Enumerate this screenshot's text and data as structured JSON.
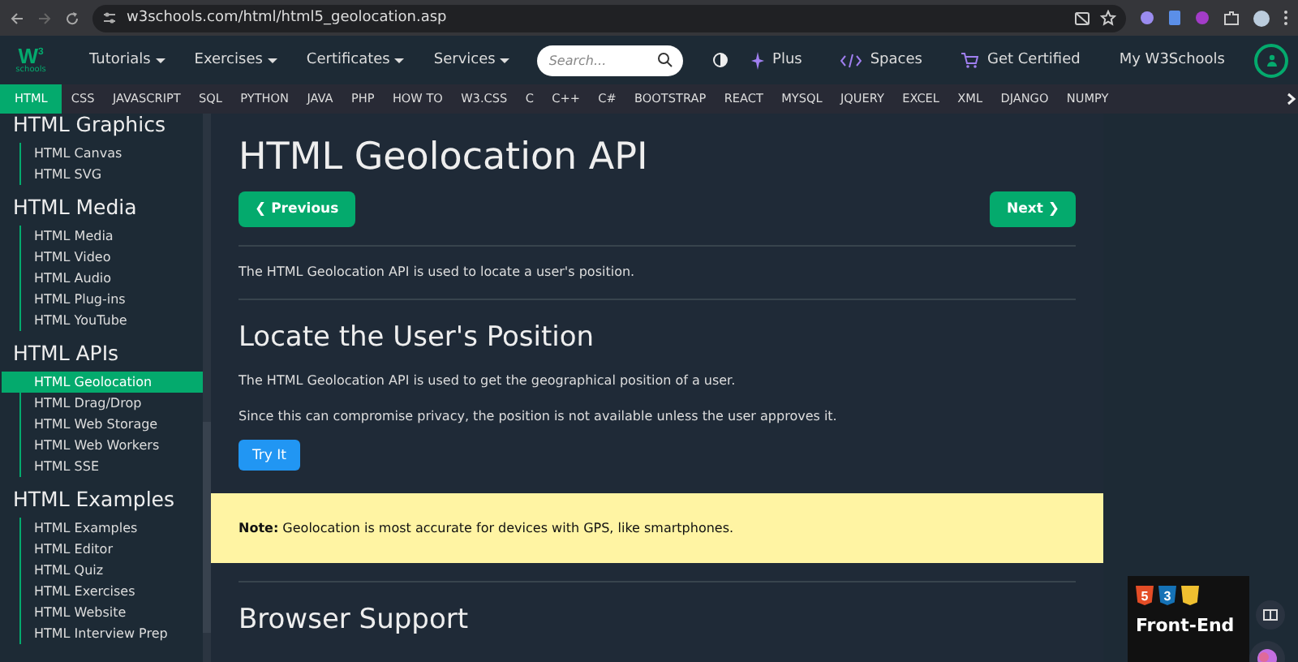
{
  "browser": {
    "url": "w3schools.com/html/html5_geolocation.asp"
  },
  "logo": {
    "mark": "W",
    "sup": "3",
    "word": "schools"
  },
  "top_nav": {
    "menus": [
      "Tutorials",
      "Exercises",
      "Certificates",
      "Services"
    ],
    "search": {
      "placeholder": "Search..."
    },
    "right_links": [
      {
        "kind": "plus",
        "label": "Plus"
      },
      {
        "kind": "spaces",
        "label": "Spaces"
      },
      {
        "kind": "cart",
        "label": "Get Certified"
      },
      {
        "kind": "plain",
        "label": "My W3Schools"
      }
    ]
  },
  "sub_nav": [
    {
      "label": "HTML",
      "selected": true
    },
    {
      "label": "CSS",
      "selected": false
    },
    {
      "label": "JAVASCRIPT",
      "selected": false
    },
    {
      "label": "SQL",
      "selected": false
    },
    {
      "label": "PYTHON",
      "selected": false
    },
    {
      "label": "JAVA",
      "selected": false
    },
    {
      "label": "PHP",
      "selected": false
    },
    {
      "label": "HOW TO",
      "selected": false
    },
    {
      "label": "W3.CSS",
      "selected": false
    },
    {
      "label": "C",
      "selected": false
    },
    {
      "label": "C++",
      "selected": false
    },
    {
      "label": "C#",
      "selected": false
    },
    {
      "label": "BOOTSTRAP",
      "selected": false
    },
    {
      "label": "REACT",
      "selected": false
    },
    {
      "label": "MYSQL",
      "selected": false
    },
    {
      "label": "JQUERY",
      "selected": false
    },
    {
      "label": "EXCEL",
      "selected": false
    },
    {
      "label": "XML",
      "selected": false
    },
    {
      "label": "DJANGO",
      "selected": false
    },
    {
      "label": "NUMPY",
      "selected": false
    }
  ],
  "sidebar": {
    "sections": [
      {
        "title": "HTML Graphics",
        "items": [
          {
            "label": "HTML Canvas",
            "selected": false
          },
          {
            "label": "HTML SVG",
            "selected": false
          }
        ]
      },
      {
        "title": "HTML Media",
        "items": [
          {
            "label": "HTML Media",
            "selected": false
          },
          {
            "label": "HTML Video",
            "selected": false
          },
          {
            "label": "HTML Audio",
            "selected": false
          },
          {
            "label": "HTML Plug-ins",
            "selected": false
          },
          {
            "label": "HTML YouTube",
            "selected": false
          }
        ]
      },
      {
        "title": "HTML APIs",
        "items": [
          {
            "label": "HTML Geolocation",
            "selected": true
          },
          {
            "label": "HTML Drag/Drop",
            "selected": false
          },
          {
            "label": "HTML Web Storage",
            "selected": false
          },
          {
            "label": "HTML Web Workers",
            "selected": false
          },
          {
            "label": "HTML SSE",
            "selected": false
          }
        ]
      },
      {
        "title": "HTML Examples",
        "items": [
          {
            "label": "HTML Examples",
            "selected": false
          },
          {
            "label": "HTML Editor",
            "selected": false
          },
          {
            "label": "HTML Quiz",
            "selected": false
          },
          {
            "label": "HTML Exercises",
            "selected": false
          },
          {
            "label": "HTML Website",
            "selected": false
          },
          {
            "label": "HTML Interview Prep",
            "selected": false
          }
        ]
      }
    ]
  },
  "main": {
    "title": "HTML Geolocation API",
    "prev": "❮ Previous",
    "next": "Next ❯",
    "intro": "The HTML Geolocation API is used to locate a user's position.",
    "section_title": "Locate the User's Position",
    "paragraphs": [
      "The HTML Geolocation API is used to get the geographical position of a user.",
      "Since this can compromise privacy, the position is not available unless the user approves it."
    ],
    "try_button": "Try It",
    "note": "**Note:** Geolocation is most accurate for devices with GPS, like smartphones.",
    "next_title": "Browser Support"
  },
  "ad": {
    "badges": [
      "5",
      "3"
    ],
    "headline": "Front-End"
  }
}
